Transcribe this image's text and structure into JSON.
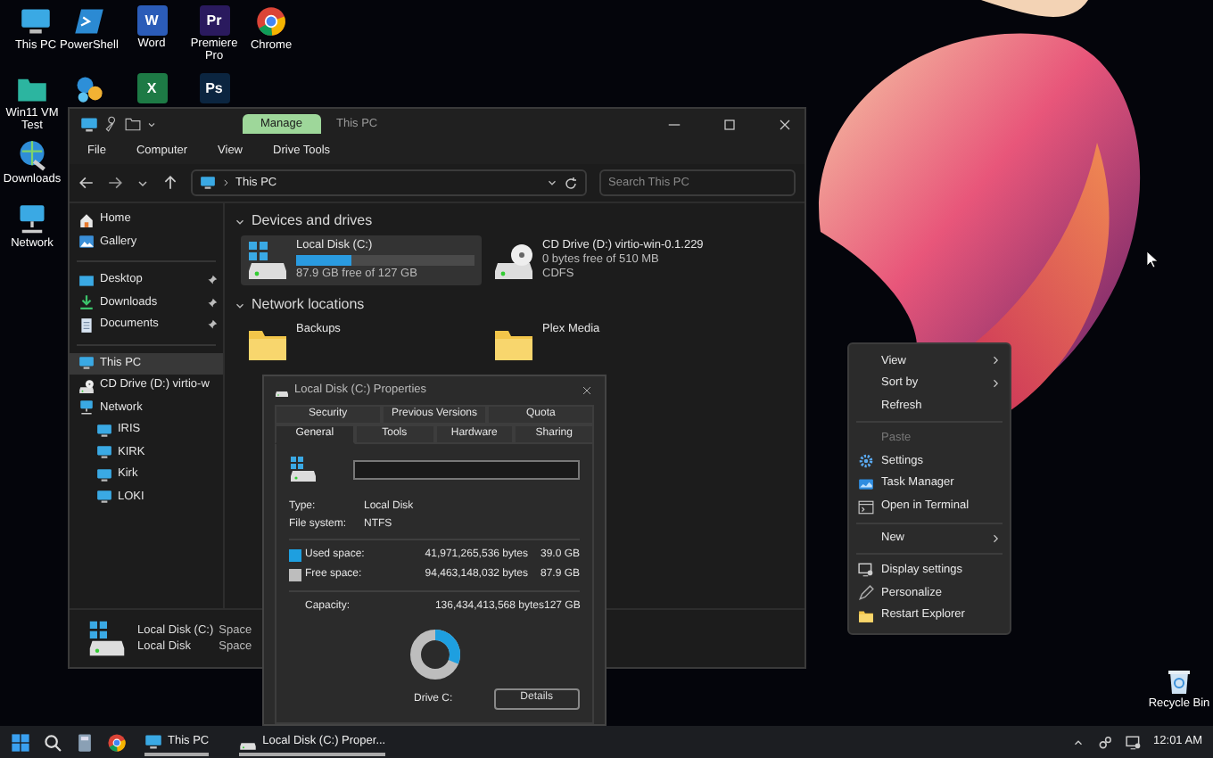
{
  "desktop_icons": [
    {
      "kind": "monitor",
      "label": "This PC"
    },
    {
      "kind": "terminal",
      "label": "PowerShell"
    },
    {
      "kind": "tile",
      "glyph": "W",
      "color": "#2b5cb8",
      "label": "Word"
    },
    {
      "kind": "tile",
      "glyph": "Pr",
      "color": "#2a1a5e",
      "label": "Premiere Pro"
    },
    {
      "kind": "chrome",
      "label": "Chrome"
    },
    {
      "kind": "folder",
      "label": "Win11 VM Test"
    },
    {
      "kind": "app"
    },
    {
      "kind": "tile",
      "glyph": "X",
      "color": "#1d7a45"
    },
    {
      "kind": "tile",
      "glyph": "Ps",
      "color": "#0b2540"
    },
    {
      "kind": "globe",
      "label": "Downloads"
    },
    {
      "kind": "network",
      "label": "Network"
    }
  ],
  "recycle_bin": {
    "label": "Recycle Bin"
  },
  "explorer": {
    "context_tab": "Manage",
    "title": "This PC",
    "ribbon_tabs": [
      "File",
      "Computer",
      "View",
      "Drive Tools"
    ],
    "address": "This PC",
    "search_placeholder": "Search This PC",
    "nav_groups": [
      [
        {
          "kind": "home",
          "label": "Home",
          "pinned": false,
          "selected": false
        },
        {
          "kind": "gallery",
          "label": "Gallery",
          "pinned": false,
          "selected": false
        }
      ],
      [
        {
          "kind": "desktop",
          "label": "Desktop",
          "pinned": true,
          "selected": false
        },
        {
          "kind": "download",
          "label": "Downloads",
          "pinned": true,
          "selected": false
        },
        {
          "kind": "document",
          "label": "Documents",
          "pinned": true,
          "selected": false
        }
      ],
      [
        {
          "kind": "pc",
          "label": "This PC",
          "pinned": false,
          "selected": true
        },
        {
          "kind": "cd",
          "label": "CD Drive (D:) virtio-w",
          "pinned": false,
          "selected": false
        },
        {
          "kind": "network",
          "label": "Network",
          "pinned": false,
          "selected": false,
          "children": [
            {
              "kind": "pc",
              "label": "IRIS",
              "pinned": false,
              "selected": false
            },
            {
              "kind": "pc",
              "label": "KIRK",
              "pinned": false,
              "selected": false
            },
            {
              "kind": "pc",
              "label": "Kirk",
              "pinned": false,
              "selected": false
            },
            {
              "kind": "pc",
              "label": "LOKI",
              "pinned": false,
              "selected": false
            }
          ]
        }
      ]
    ],
    "sections": [
      {
        "title": "Devices and drives",
        "expanded": true,
        "items": [
          {
            "kind": "disk",
            "name": "Local Disk (C:)",
            "level": 0.31,
            "details": [
              "87.9 GB free of 127 GB"
            ],
            "selected": true
          },
          {
            "kind": "cd",
            "name": "CD Drive (D:) virtio-win-0.1.229",
            "details": [
              "0 bytes free of 510 MB",
              "CDFS"
            ],
            "selected": false
          }
        ]
      },
      {
        "title": "Network locations",
        "expanded": true,
        "items": [
          {
            "kind": "folder",
            "name": "Backups",
            "selected": false
          },
          {
            "kind": "folder",
            "name": "Plex Media",
            "selected": false
          }
        ]
      }
    ],
    "details_pane": {
      "lines": [
        [
          "Local Disk (C:)",
          "Space"
        ],
        [
          "Local Disk",
          "Space"
        ]
      ]
    }
  },
  "properties": {
    "title": "Local Disk (C:) Properties",
    "tab_rows": [
      [
        {
          "label": "Security",
          "selected": false
        },
        {
          "label": "Previous Versions",
          "selected": false
        },
        {
          "label": "Quota",
          "selected": false
        }
      ],
      [
        {
          "label": "General",
          "selected": true
        },
        {
          "label": "Tools",
          "selected": false
        },
        {
          "label": "Hardware",
          "selected": false
        },
        {
          "label": "Sharing",
          "selected": false
        }
      ]
    ],
    "fields": [
      {
        "label": "Type:",
        "value": "Local Disk"
      },
      {
        "label": "File system:",
        "value": "NTFS"
      }
    ],
    "space": [
      {
        "label": "Used space:",
        "bytes": "41,971,265,536 bytes",
        "size": "39.0 GB",
        "color": "#1e9fe0"
      },
      {
        "label": "Free space:",
        "bytes": "94,463,148,032 bytes",
        "size": "87.9 GB",
        "color": "#bdbdbd"
      }
    ],
    "capacity": {
      "label": "Capacity:",
      "bytes": "136,434,413,568 bytes",
      "size": "127 GB"
    },
    "usage": {
      "level": 0.31
    },
    "drive_label": "Drive C:",
    "details_button": "Details"
  },
  "context_menu": [
    {
      "kind": "submenu",
      "label": "View",
      "disabled": false
    },
    {
      "kind": "submenu",
      "label": "Sort by",
      "disabled": false
    },
    {
      "kind": "plain",
      "label": "Refresh",
      "disabled": false
    },
    {
      "kind": "separator"
    },
    {
      "kind": "plain",
      "label": "Paste",
      "disabled": true
    },
    {
      "kind": "settings",
      "label": "Settings",
      "disabled": false
    },
    {
      "kind": "taskmanager",
      "label": "Task Manager",
      "disabled": false
    },
    {
      "kind": "terminal",
      "label": "Open in Terminal",
      "disabled": false
    },
    {
      "kind": "separator"
    },
    {
      "kind": "submenu",
      "label": "New",
      "disabled": false
    },
    {
      "kind": "separator"
    },
    {
      "kind": "display",
      "label": "Display settings",
      "disabled": false
    },
    {
      "kind": "personalize",
      "label": "Personalize",
      "disabled": false
    },
    {
      "kind": "restart",
      "label": "Restart Explorer",
      "disabled": false
    }
  ],
  "taskbar": {
    "apps": [
      {
        "kind": "start"
      },
      {
        "kind": "search"
      },
      {
        "kind": "calculator"
      },
      {
        "kind": "chrome"
      },
      {
        "kind": "explorer",
        "label": "This PC",
        "running": true
      },
      {
        "kind": "drive",
        "label": "Local Disk (C:) Proper...",
        "running": true
      }
    ],
    "time": "12:01 AM"
  }
}
